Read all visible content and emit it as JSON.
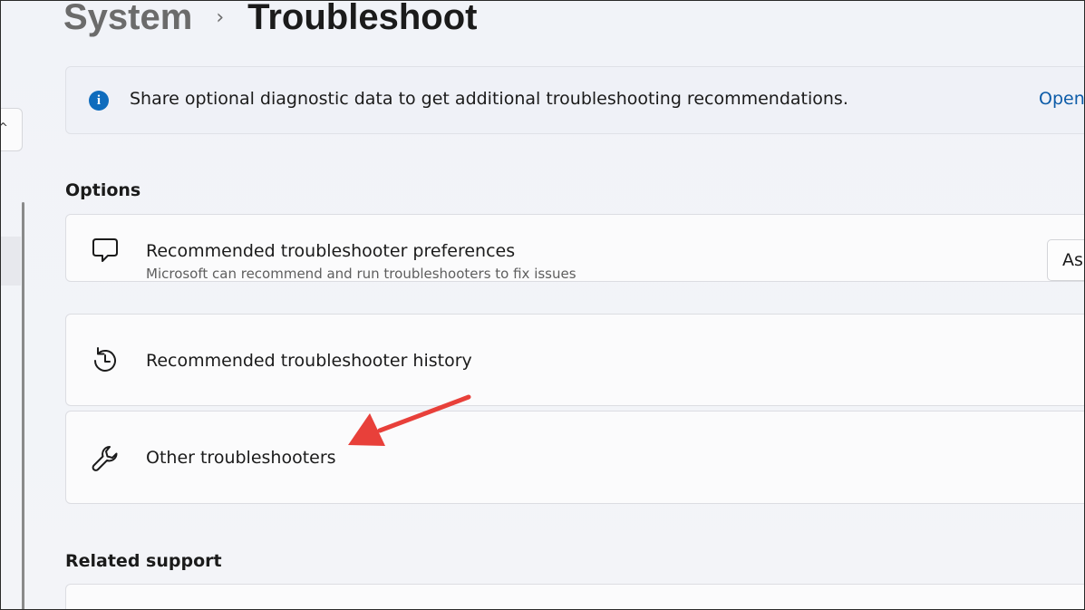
{
  "breadcrumb": {
    "parent": "System",
    "separator": "›",
    "current": "Troubleshoot"
  },
  "banner": {
    "icon": "info-icon",
    "text": "Share optional diagnostic data to get additional troubleshooting recommendations.",
    "link": "Open"
  },
  "options": {
    "title": "Options",
    "items": [
      {
        "icon": "chat-bubble-icon",
        "title": "Recommended troubleshooter preferences",
        "subtitle": "Microsoft can recommend and run troubleshooters to fix issues",
        "control_value": "As"
      },
      {
        "icon": "history-icon",
        "title": "Recommended troubleshooter history"
      },
      {
        "icon": "wrench-icon",
        "title": "Other troubleshooters"
      }
    ]
  },
  "related": {
    "title": "Related support"
  },
  "colors": {
    "accent": "#0f6cbd",
    "annotation_arrow": "#e8403a"
  }
}
